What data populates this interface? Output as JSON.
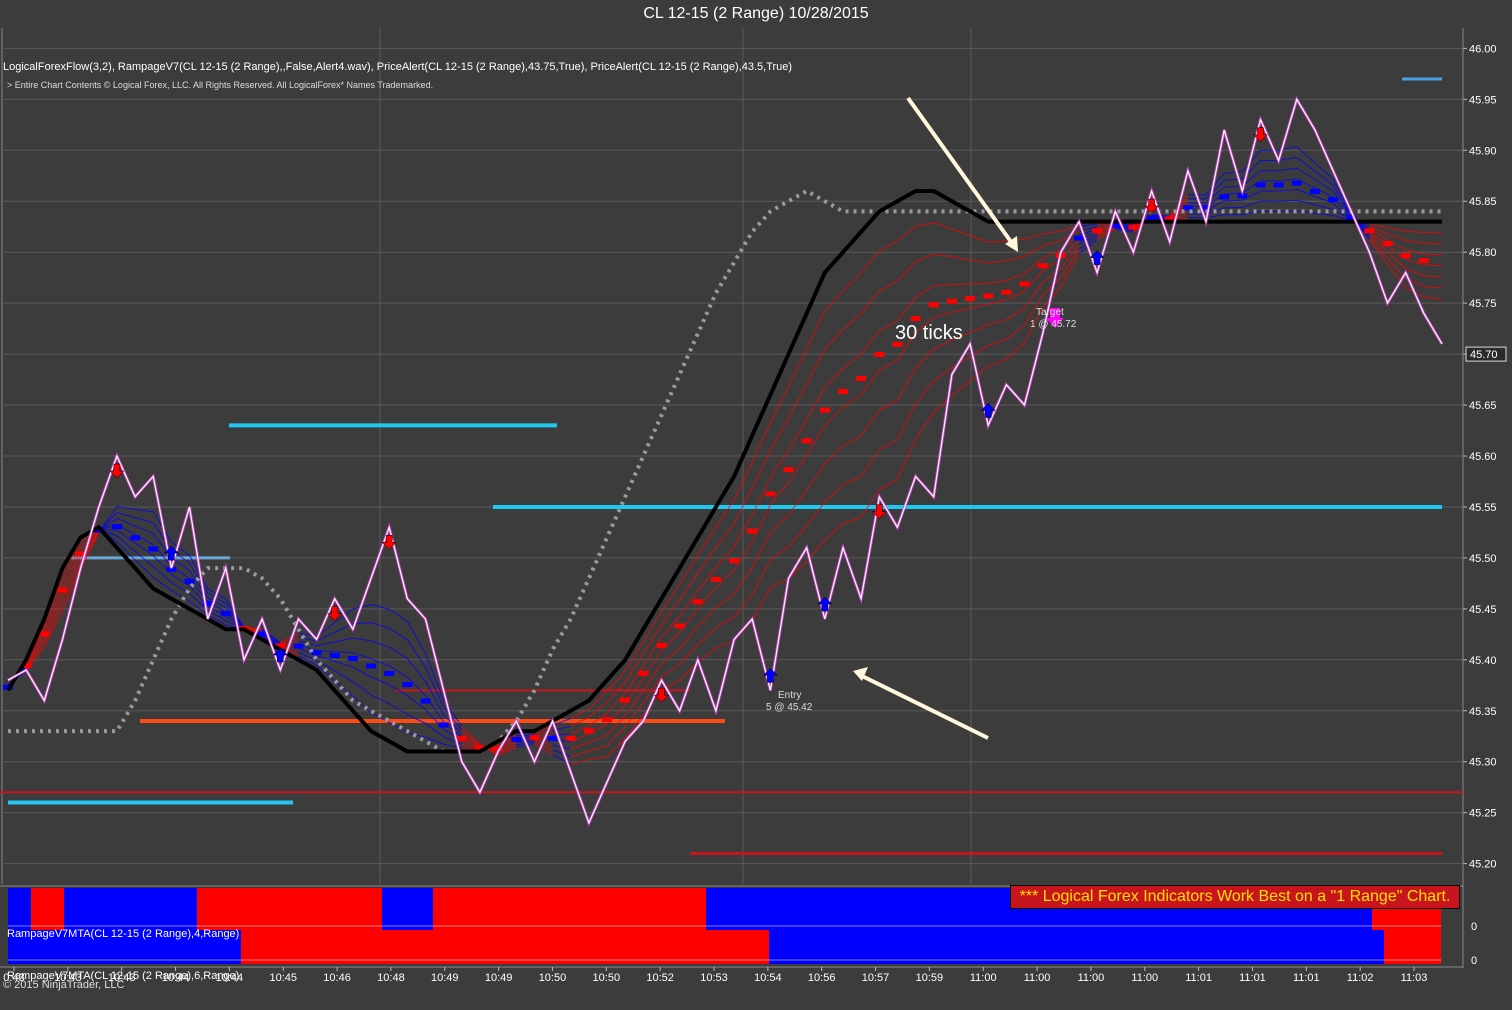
{
  "window": {
    "title": "CL 12-15 (2 Range)  10/28/2015"
  },
  "header": {
    "indicators": "LogicalForexFlow(3,2),  RampageV7(CL 12-15 (2 Range),,False,Alert4.wav), PriceAlert(CL 12-15 (2 Range),43.75,True), PriceAlert(CL 12-15 (2 Range),43.5,True)",
    "copyright": "> Entire Chart Contents © Logical Forex, LLC. All Rights Reserved. All LogicalForex* Names Trademarked."
  },
  "annotations": {
    "ticks": "30 ticks",
    "target_line1": "Target",
    "target_line2": "1 @ 45.72",
    "entry_line1": "Entry",
    "entry_line2": "5 @ 45.42",
    "banner": "*** Logical Forex Indicators Work Best on a \"1 Range\" Chart."
  },
  "panels": {
    "mta4": "RampageV7MTA(CL 12-15 (2 Range),4,Range)",
    "mta6": "RampageV7MTA(CL 12-15 (2 Range),6,Range)",
    "ninja": "© 2015 NinjaTrader, LLC",
    "zero": "0"
  },
  "colors": {
    "background": "#3c3c3c",
    "price": "#ffffff",
    "price_glow": "#e040e0",
    "bull": "#0000ff",
    "bear": "#ff0000",
    "ma_slow": "#000000",
    "ma_dotted": "#9a9a9a",
    "level_light_blue": "#1ec8f0",
    "level_orange": "#ff4a14",
    "level_red": "#c8141c",
    "arrow_cream": "#fff8dc",
    "target_marker": "#ff00ff",
    "banner_text": "#ffe000"
  },
  "chart_data": {
    "type": "line",
    "title": "CL 12-15 (2 Range)  10/28/2015",
    "ylim": [
      45.18,
      46.02
    ],
    "y_ticks": [
      "46.00",
      "45.95",
      "45.90",
      "45.85",
      "45.80",
      "45.75",
      "45.70",
      "45.65",
      "45.60",
      "45.55",
      "45.50",
      "45.45",
      "45.40",
      "45.35",
      "45.30",
      "45.25",
      "45.20"
    ],
    "last_price": "45.70",
    "x_tick_labels": [
      "0:43",
      "10:43",
      "10:43",
      "10:44",
      "10:44",
      "10:45",
      "10:46",
      "10:48",
      "10:49",
      "10:49",
      "10:50",
      "10:50",
      "10:52",
      "10:53",
      "10:54",
      "10:56",
      "10:57",
      "10:59",
      "11:00",
      "11:00",
      "11:00",
      "11:00",
      "11:01",
      "11:01",
      "11:01",
      "11:02",
      "11:03"
    ],
    "grid": true,
    "series": [
      {
        "values": [
          45.38,
          45.39,
          45.36,
          45.42,
          45.49,
          45.55,
          45.6,
          45.56,
          45.58,
          45.49,
          45.55,
          45.44,
          45.49,
          45.4,
          45.44,
          45.39,
          45.44,
          45.42,
          45.46,
          45.43,
          45.48,
          45.53,
          45.46,
          45.44,
          45.37,
          45.3,
          45.27,
          45.31,
          45.34,
          45.3,
          45.34,
          45.29,
          45.24,
          45.28,
          45.32,
          45.34,
          45.38,
          45.35,
          45.4,
          45.35,
          45.42,
          45.44,
          45.37,
          45.48,
          45.51,
          45.44,
          45.51,
          45.46,
          45.56,
          45.53,
          45.58,
          45.56,
          45.68,
          45.71,
          45.63,
          45.67,
          45.65,
          45.72,
          45.8,
          45.83,
          45.78,
          45.84,
          45.8,
          45.86,
          45.81,
          45.88,
          45.83,
          45.92,
          45.86,
          45.93,
          45.89,
          45.95,
          45.92,
          45.88,
          45.84,
          45.8,
          45.75,
          45.78,
          45.74,
          45.71
        ]
      },
      {
        "values": [
          45.37,
          45.4,
          45.44,
          45.49,
          45.52,
          45.53,
          45.51,
          45.49,
          45.47,
          45.46,
          45.45,
          45.44,
          45.43,
          45.43,
          45.42,
          45.41,
          45.4,
          45.39,
          45.37,
          45.35,
          45.33,
          45.32,
          45.31,
          45.31,
          45.31,
          45.31,
          45.31,
          45.32,
          45.33,
          45.33,
          45.34,
          45.35,
          45.36,
          45.38,
          45.4,
          45.43,
          45.46,
          45.49,
          45.52,
          45.55,
          45.58,
          45.62,
          45.66,
          45.7,
          45.74,
          45.78,
          45.8,
          45.82,
          45.84,
          45.85,
          45.86,
          45.86,
          45.85,
          45.84,
          45.83,
          45.83,
          45.83,
          45.83,
          45.83,
          45.83,
          45.83,
          45.83,
          45.83,
          45.83,
          45.83,
          45.83,
          45.83,
          45.83,
          45.83,
          45.83,
          45.83,
          45.83,
          45.83,
          45.83,
          45.83,
          45.83,
          45.83,
          45.83,
          45.83,
          45.83
        ]
      },
      {
        "values": [
          45.33,
          45.36,
          45.4,
          45.44,
          45.47,
          45.49,
          45.49,
          45.49,
          45.48,
          45.46,
          45.43,
          45.4,
          45.38,
          45.36,
          45.35,
          45.34,
          45.33,
          45.32,
          45.31,
          45.31,
          45.31,
          45.32,
          45.34,
          45.37,
          45.41,
          45.44,
          45.48,
          45.52,
          45.56,
          45.6,
          45.64,
          45.68,
          45.72,
          45.76,
          45.79,
          45.82,
          45.84,
          45.85,
          45.86,
          45.85,
          45.84,
          45.84,
          45.84,
          45.84,
          45.84,
          45.84,
          45.84,
          45.84,
          45.84,
          45.84,
          45.84,
          45.84,
          45.84,
          45.84,
          45.84,
          45.84,
          45.84,
          45.84,
          45.84,
          45.84,
          45.84,
          45.84,
          45.84,
          45.84,
          45.84,
          45.84,
          45.84,
          45.84,
          45.84,
          45.84,
          45.84,
          45.84,
          45.84,
          45.84,
          45.84,
          45.84,
          45.84,
          45.84,
          45.84,
          45.84
        ]
      }
    ],
    "levels": [
      45.97,
      45.63,
      45.55,
      45.5,
      45.37,
      45.34,
      45.27,
      45.26,
      45.21
    ]
  }
}
